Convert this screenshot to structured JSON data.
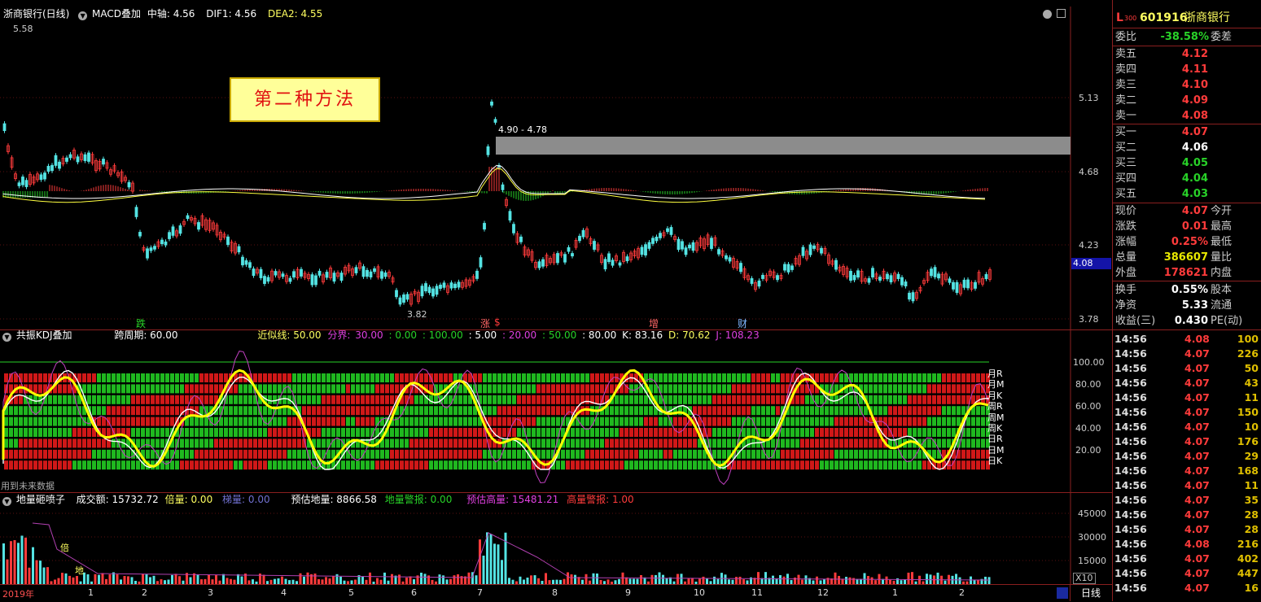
{
  "main_panel": {
    "stock_title": "浙商银行(日线)",
    "indicator": "MACD叠加",
    "mid_axis": "中轴: 4.56",
    "dif": "DIF1: 4.56",
    "dea": "DEA2: 4.55",
    "high_marker": "5.58",
    "low_marker": "3.82",
    "zone_label": "4.90 - 4.78",
    "method_label": "第二种方法",
    "price_axis": [
      "5.13",
      "4.68",
      "4.23",
      "3.78"
    ],
    "current_price_tag": "4.08",
    "events": [
      {
        "label": "跌",
        "color": "#28d228"
      },
      {
        "label": "涨",
        "color": "#ff6666"
      },
      {
        "label": "$",
        "color": "#ff3b3b"
      },
      {
        "label": "增",
        "color": "#ff6666"
      },
      {
        "label": "财",
        "color": "#7fb7ff"
      }
    ]
  },
  "kdj_panel": {
    "title": "共振KDJ叠加",
    "period": "跨周期: 60.00",
    "approx": "近似线: 50.00",
    "boundary_label": "分界:",
    "b1": "30.00",
    "b2": ": 0.00",
    "b3": ": 100.00",
    "b4": ": 5.00",
    "b5": ": 20.00",
    "b6": ": 50.00",
    "b7": ": 80.00",
    "k": "K: 83.16",
    "d": "D: 70.62",
    "j": "J: 108.23",
    "axis": [
      "100.00",
      "80.00",
      "60.00",
      "40.00",
      "20.00"
    ],
    "row_labels": [
      "月R",
      "月M",
      "月K",
      "周R",
      "周M",
      "周K",
      "日R",
      "日M",
      "日K"
    ],
    "future_data": "用到未来数据"
  },
  "vol_panel": {
    "title": "地量砸喷子",
    "amount": "成交额: 15732.72",
    "multiple": "倍量: 0.00",
    "step": "梯量: 0.00",
    "est_low": "预估地量: 8866.58",
    "low_alert": "地量警报: 0.00",
    "est_high": "预估高量: 15481.21",
    "high_alert": "高量警报: 1.00",
    "axis": [
      "45000",
      "30000",
      "15000"
    ],
    "x10": "X10",
    "bei": "倍",
    "di": "地"
  },
  "timeline": {
    "start": "2019年",
    "months": [
      "1",
      "2",
      "3",
      "4",
      "5",
      "6",
      "7",
      "8",
      "9",
      "10",
      "11",
      "12",
      "1",
      "2"
    ],
    "period_btn": "日线"
  },
  "quote": {
    "market": "L",
    "market_sub": "300",
    "code": "601916",
    "name": "浙商银行",
    "weibi_label": "委比",
    "weibi": "-38.58%",
    "weicha_label": "委差",
    "asks": [
      {
        "label": "卖五",
        "price": "4.12"
      },
      {
        "label": "卖四",
        "price": "4.11"
      },
      {
        "label": "卖三",
        "price": "4.10"
      },
      {
        "label": "卖二",
        "price": "4.09"
      },
      {
        "label": "卖一",
        "price": "4.08"
      }
    ],
    "bids": [
      {
        "label": "买一",
        "price": "4.07"
      },
      {
        "label": "买二",
        "price": "4.06"
      },
      {
        "label": "买三",
        "price": "4.05"
      },
      {
        "label": "买四",
        "price": "4.04"
      },
      {
        "label": "买五",
        "price": "4.03"
      }
    ],
    "stats": [
      {
        "label": "现价",
        "value": "4.07",
        "label2": "今开"
      },
      {
        "label": "涨跌",
        "value": "0.01",
        "label2": "最高"
      },
      {
        "label": "涨幅",
        "value": "0.25%",
        "label2": "最低"
      },
      {
        "label": "总量",
        "value": "386607",
        "label2": "量比"
      },
      {
        "label": "外盘",
        "value": "178621",
        "label2": "内盘"
      }
    ],
    "stats2": [
      {
        "label": "换手",
        "value": "0.55%",
        "label2": "股本"
      },
      {
        "label": "净资",
        "value": "5.33",
        "label2": "流通"
      },
      {
        "label": "收益(三)",
        "value": "0.430",
        "label2": "PE(动)"
      }
    ],
    "ticks": [
      {
        "t": "14:56",
        "p": "4.08",
        "q": "100"
      },
      {
        "t": "14:56",
        "p": "4.07",
        "q": "226"
      },
      {
        "t": "14:56",
        "p": "4.07",
        "q": "50"
      },
      {
        "t": "14:56",
        "p": "4.07",
        "q": "43"
      },
      {
        "t": "14:56",
        "p": "4.07",
        "q": "11"
      },
      {
        "t": "14:56",
        "p": "4.07",
        "q": "150"
      },
      {
        "t": "14:56",
        "p": "4.07",
        "q": "10"
      },
      {
        "t": "14:56",
        "p": "4.07",
        "q": "176"
      },
      {
        "t": "14:56",
        "p": "4.07",
        "q": "29"
      },
      {
        "t": "14:56",
        "p": "4.07",
        "q": "168"
      },
      {
        "t": "14:56",
        "p": "4.07",
        "q": "11"
      },
      {
        "t": "14:56",
        "p": "4.07",
        "q": "35"
      },
      {
        "t": "14:56",
        "p": "4.07",
        "q": "28"
      },
      {
        "t": "14:56",
        "p": "4.07",
        "q": "28"
      },
      {
        "t": "14:56",
        "p": "4.08",
        "q": "216"
      },
      {
        "t": "14:56",
        "p": "4.07",
        "q": "402"
      },
      {
        "t": "14:56",
        "p": "4.07",
        "q": "447"
      },
      {
        "t": "14:56",
        "p": "4.07",
        "q": "16"
      }
    ]
  }
}
